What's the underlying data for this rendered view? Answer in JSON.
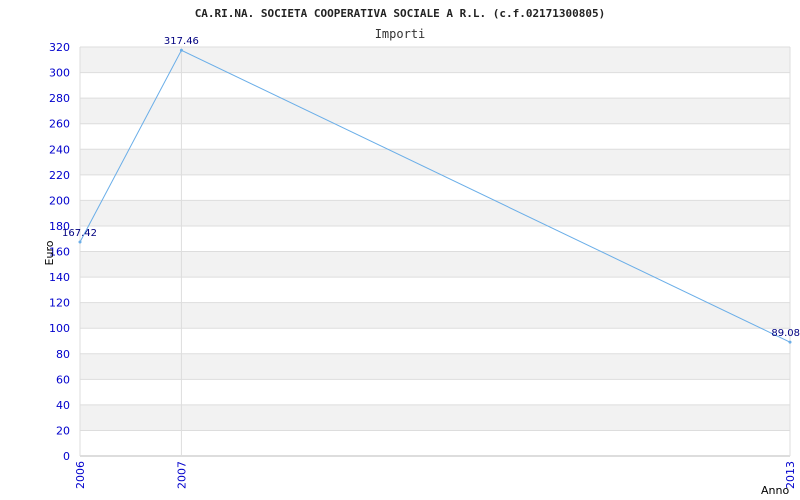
{
  "chart_data": {
    "type": "line",
    "title": "CA.RI.NA. SOCIETA COOPERATIVA SOCIALE A R.L. (c.f.02171300805)",
    "subtitle": "Importi",
    "xlabel": "Anno",
    "ylabel": "Euro",
    "categories": [
      "2006",
      "2007",
      "2013"
    ],
    "series": [
      {
        "name": "",
        "values": [
          167.42,
          317.46,
          89.08
        ],
        "labels": [
          "167.42",
          "317.46",
          "89.08"
        ]
      }
    ],
    "ylim": [
      0,
      320
    ],
    "yticks": [
      0,
      20,
      40,
      60,
      80,
      100,
      120,
      140,
      160,
      180,
      200,
      220,
      240,
      260,
      280,
      300,
      320
    ],
    "grid": true,
    "colors": {
      "line": "#6aaee8",
      "band": "#f2f2f2",
      "grid": "#dddddd",
      "tick": "#0000cc",
      "label": "#000080"
    }
  }
}
